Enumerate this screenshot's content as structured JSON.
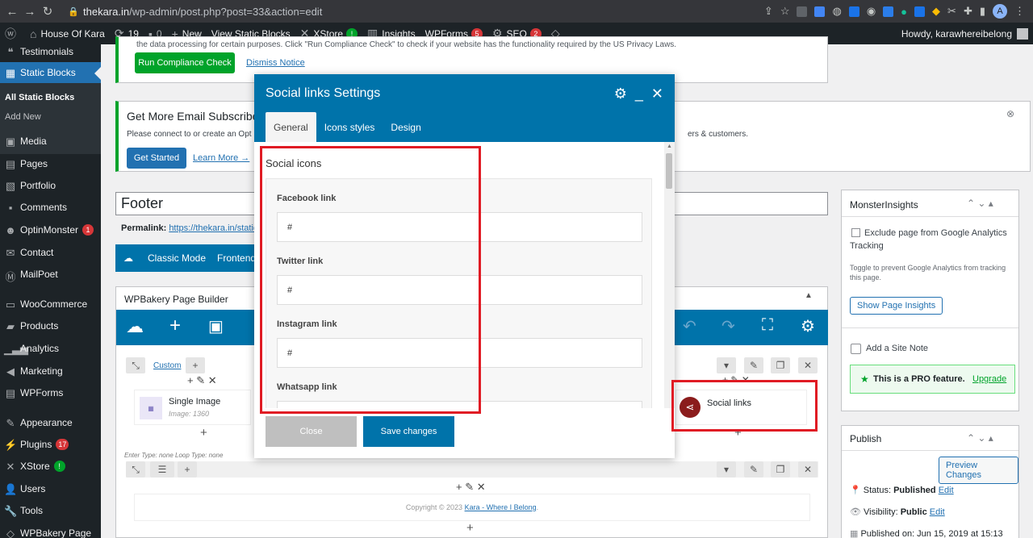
{
  "browser": {
    "url_host": "thekara.in",
    "url_path": "/wp-admin/post.php?post=33&action=edit",
    "profile_initial": "A"
  },
  "adminbar": {
    "site_name": "House Of Kara",
    "updates_count": "19",
    "comments_count": "0",
    "new_label": "New",
    "view_label": "View Static Blocks",
    "xstore_label": "XStore",
    "xstore_badge": "!",
    "insights_label": "Insights",
    "wpforms_label": "WPForms",
    "wpforms_badge": "5",
    "seo_label": "SEO",
    "seo_badge": "2",
    "howdy": "Howdy, karawhereibelong"
  },
  "sidebar": {
    "items": [
      {
        "label": "Testimonials",
        "icon": "quote-icon"
      },
      {
        "label": "Static Blocks",
        "icon": "blocks-icon"
      },
      {
        "label": "Media",
        "icon": "media-icon"
      },
      {
        "label": "Pages",
        "icon": "pages-icon"
      },
      {
        "label": "Portfolio",
        "icon": "portfolio-icon"
      },
      {
        "label": "Comments",
        "icon": "comments-icon"
      },
      {
        "label": "OptinMonster",
        "icon": "optinmonster-icon",
        "badge": "1"
      },
      {
        "label": "Contact",
        "icon": "contact-icon"
      },
      {
        "label": "MailPoet",
        "icon": "mailpoet-icon"
      },
      {
        "label": "WooCommerce",
        "icon": "woocommerce-icon"
      },
      {
        "label": "Products",
        "icon": "products-icon"
      },
      {
        "label": "Analytics",
        "icon": "analytics-icon"
      },
      {
        "label": "Marketing",
        "icon": "marketing-icon"
      },
      {
        "label": "WPForms",
        "icon": "wpforms-icon"
      },
      {
        "label": "Appearance",
        "icon": "appearance-icon"
      },
      {
        "label": "Plugins",
        "icon": "plugins-icon",
        "badge": "17"
      },
      {
        "label": "XStore",
        "icon": "xstore-icon",
        "badge": "!"
      },
      {
        "label": "Users",
        "icon": "users-icon"
      },
      {
        "label": "Tools",
        "icon": "tools-icon"
      },
      {
        "label": "WPBakery Page",
        "icon": "wpbakery-icon"
      }
    ],
    "submenu": [
      "All Static Blocks",
      "Add New"
    ]
  },
  "main": {
    "notice1_tail": "the data processing for certain purposes. Click \"Run Compliance Check\" to check if your website has the functionality required by the US Privacy Laws.",
    "run_compliance": "Run Compliance Check",
    "dismiss": "Dismiss Notice",
    "email_title": "Get More Email Subscriber",
    "email_text": "Please connect to or create an Opt",
    "email_text_right": "ers & customers.",
    "get_started": "Get Started",
    "learn_more": "Learn More →",
    "post_title": "Footer",
    "permalink_label": "Permalink:",
    "permalink_url": "https://thekara.in/staticb",
    "classic_mode": "Classic Mode",
    "frontend": "Frontend",
    "wpbakery_title": "WPBakery Page Builder",
    "custom_label": "Custom",
    "single_image": "Single Image",
    "image_meta": "Image: 1360",
    "enter_type": "Enter Type: none  Loop Type: none",
    "social_links": "Social links",
    "copyright": "Copyright © 2023",
    "copyright_link": "Kara - Where I Belong"
  },
  "right": {
    "mi_title": "MonsterInsights",
    "exclude_label": "Exclude page from Google Analytics Tracking",
    "toggle_help": "Toggle to prevent Google Analytics from tracking this page.",
    "show_insights": "Show Page Insights",
    "site_note": "Add a Site Note",
    "pro_feature": "This is a PRO feature.",
    "upgrade": "Upgrade",
    "publish_title": "Publish",
    "preview_changes": "Preview Changes",
    "status_label": "Status:",
    "status_value": "Published",
    "edit": "Edit",
    "visibility_label": "Visibility:",
    "visibility_value": "Public",
    "published_on": "Published on: Jun 15, 2019 at 15:13"
  },
  "modal": {
    "title": "Social links Settings",
    "tabs": [
      "General",
      "Icons styles",
      "Design"
    ],
    "section_title": "Social icons",
    "fields": [
      {
        "label": "Facebook link",
        "value": "#"
      },
      {
        "label": "Twitter link",
        "value": "#"
      },
      {
        "label": "Instagram link",
        "value": "#"
      },
      {
        "label": "Whatsapp link",
        "value": ""
      }
    ],
    "close_label": "Close",
    "save_label": "Save changes"
  },
  "colors": {
    "wp_dark": "#1d2327",
    "wp_blue": "#2271b1",
    "modal_blue": "#0073aa",
    "highlight_red": "#e01b24",
    "green": "#00a32a"
  }
}
